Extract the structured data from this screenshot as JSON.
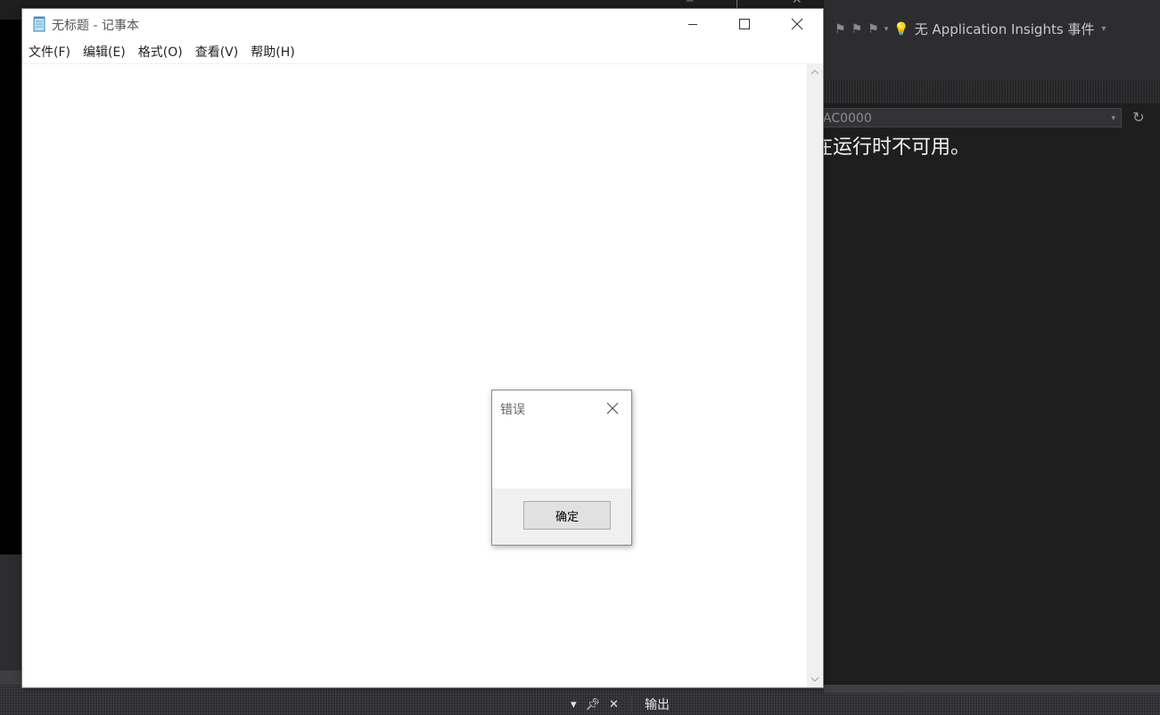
{
  "background_app": {
    "toolbar_insights_label": "无 Application Insights 事件",
    "combo_value": "AC0000",
    "message_fragment": "在运行时不可用。",
    "output_tab_label": "输出"
  },
  "notepad": {
    "title": "无标题 - 记事本",
    "menu": [
      {
        "label": "文件(F)"
      },
      {
        "label": "编辑(E)"
      },
      {
        "label": "格式(O)"
      },
      {
        "label": "查看(V)"
      },
      {
        "label": "帮助(H)"
      }
    ],
    "content": ""
  },
  "error_dialog": {
    "title": "错误",
    "message": "",
    "ok_label": "确定"
  },
  "colors": {
    "vs_background": "#1e1e1e",
    "vs_toolbar": "#2d2d30",
    "dialog_footer": "#f0f0f0",
    "button_face": "#e1e1e1"
  }
}
